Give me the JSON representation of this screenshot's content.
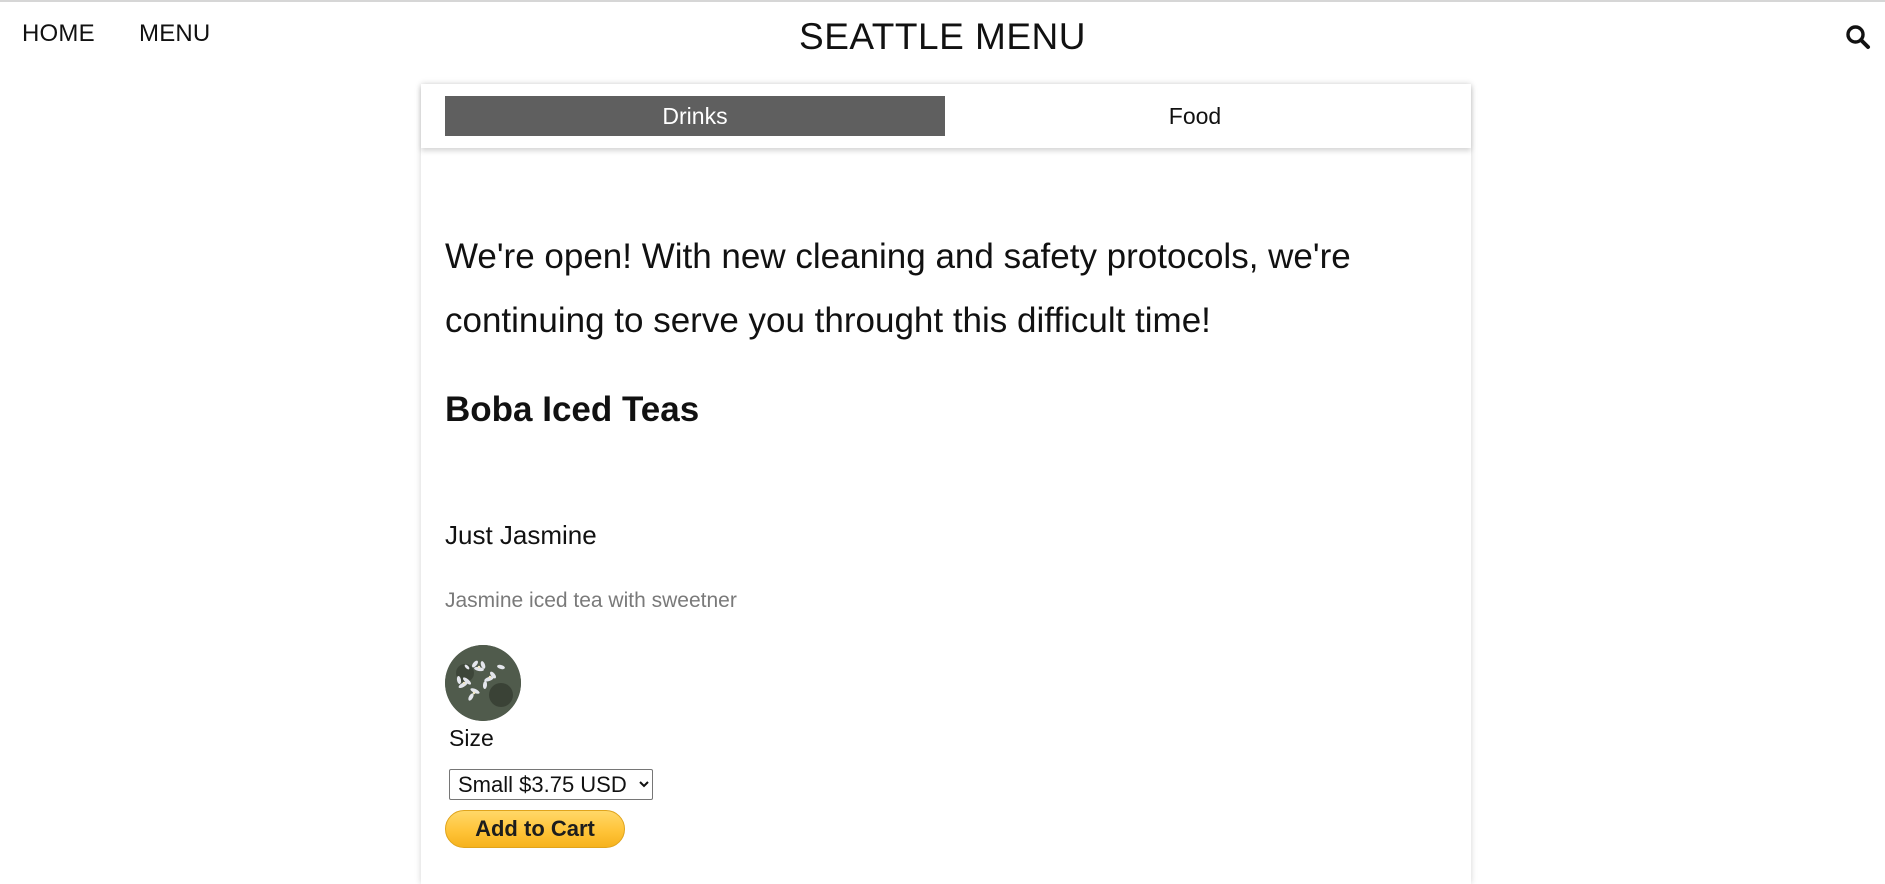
{
  "header": {
    "nav": [
      {
        "label": "HOME"
      },
      {
        "label": "MENU"
      }
    ],
    "title": "SEATTLE MENU",
    "search_icon": "search-icon"
  },
  "tabs": [
    {
      "label": "Drinks",
      "active": true
    },
    {
      "label": "Food",
      "active": false
    }
  ],
  "announcement": "We're open! With new cleaning and safety protocols, we're continuing to serve you throught this difficult time!",
  "section": {
    "heading": "Boba Iced Teas",
    "items": [
      {
        "name": "Just Jasmine",
        "description": "Jasmine iced tea with sweetner",
        "size_label": "Size",
        "size_options": [
          "Small $3.75 USD"
        ],
        "selected_size": "Small $3.75 USD",
        "cart_label": "Add to Cart"
      }
    ]
  },
  "colors": {
    "active_tab_bg": "#5f5f5f",
    "active_tab_text": "#ffffff",
    "description_text": "#7a7a7a",
    "cart_button": "#ffc439"
  }
}
